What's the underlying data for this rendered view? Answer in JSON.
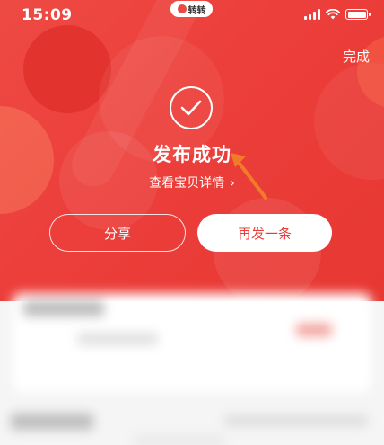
{
  "status_bar": {
    "time": "15:09",
    "app_pill": "转转"
  },
  "header": {
    "done_label": "完成"
  },
  "success": {
    "title": "发布成功",
    "view_link": "查看宝贝详情",
    "view_link_chevron": "›"
  },
  "actions": {
    "share_label": "分享",
    "repost_label": "再发一条"
  },
  "colors": {
    "hero_red": "#ec3e3a",
    "annotation_arrow": "#f07c2a",
    "button_text": "#e73f3a"
  }
}
